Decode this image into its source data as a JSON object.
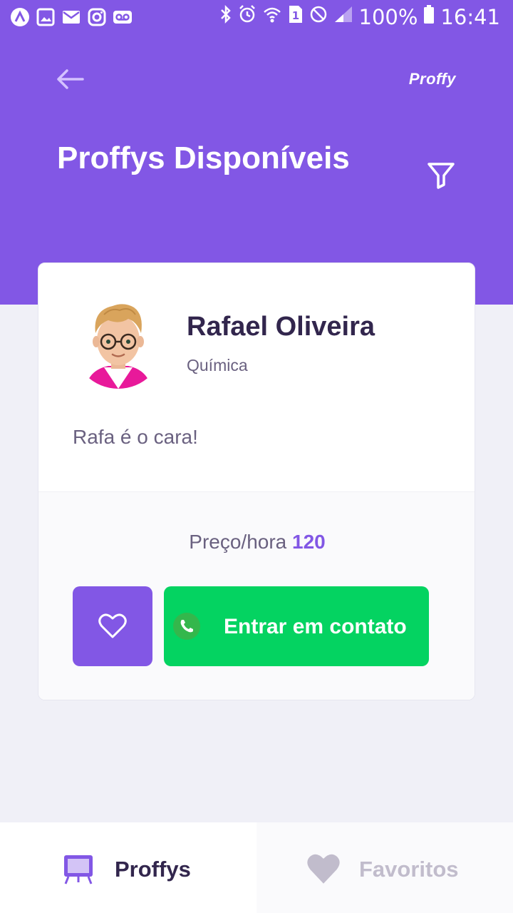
{
  "status_bar": {
    "battery": "100%",
    "time": "16:41",
    "left_icons": [
      "app-icon",
      "image-icon",
      "mail-icon",
      "instagram-icon",
      "voicemail-icon"
    ],
    "right_icons": [
      "bluetooth-icon",
      "alarm-icon",
      "wifi-icon",
      "sim-icon",
      "dnd-icon",
      "signal-icon",
      "battery-icon"
    ]
  },
  "header": {
    "logo": "Proffy",
    "title": "Proffys Disponíveis",
    "back_icon": "arrow-left-icon",
    "filter_icon": "filter-icon"
  },
  "teacher": {
    "name": "Rafael Oliveira",
    "subject": "Química",
    "bio": "Rafa é o cara!",
    "price_label": "Preço/hora",
    "price_value": "120",
    "favorite_icon": "heart-outline-icon",
    "contact_label": "Entrar em contato",
    "contact_icon": "whatsapp-icon"
  },
  "tabs": [
    {
      "label": "Proffys",
      "icon": "easel-icon",
      "active": true
    },
    {
      "label": "Favoritos",
      "icon": "heart-icon",
      "active": false
    }
  ],
  "colors": {
    "primary": "#8257E5",
    "green": "#04D361",
    "text_title": "#32264D",
    "text_base": "#6A6180",
    "background": "#F0F0F7"
  }
}
